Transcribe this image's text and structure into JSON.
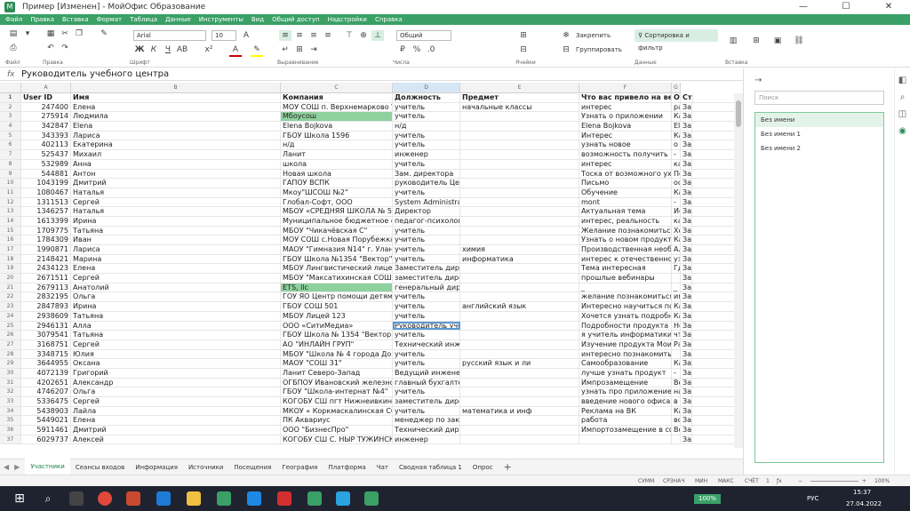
{
  "window": {
    "title": "Пример [Изменен] - МойОфис Образование",
    "logo": "М"
  },
  "menu": [
    "Файл",
    "Правка",
    "Вставка",
    "Формат",
    "Таблица",
    "Данные",
    "Инструменты",
    "Вид",
    "Общий доступ",
    "Надстройки",
    "Справка"
  ],
  "ribbon": {
    "groups": [
      "Файл",
      "Правка",
      "Шрифт",
      "Выравнивание",
      "Числа",
      "Ячейки",
      "Данные",
      "Вставка"
    ],
    "font_name": "Arial",
    "font_size": "10",
    "number_format": "Общий",
    "freeze_label": "Закрепить",
    "group_label": "Группировать",
    "sort_filter_label": "Сортировка и фильтр"
  },
  "formula": {
    "fx": "fx",
    "value": "Руководитель учебного центра"
  },
  "columns": [
    "A",
    "B",
    "C",
    "D",
    "E",
    "F",
    "G"
  ],
  "headers": [
    "User ID",
    "Имя",
    "Компания",
    "Должность",
    "Предмет",
    "Что вас привело на вебина",
    "Ответ на какой вопр",
    "Ст"
  ],
  "rows": [
    [
      "2",
      "247400",
      "Елена",
      "МОУ СОШ п. Верхнемарково УКМО",
      "учитель",
      "начальные классы",
      "интерес",
      "рассылка",
      "За"
    ],
    [
      "3",
      "275914",
      "Людмила",
      "Мбоусош",
      "учитель",
      "",
      "Узнать о приложении",
      "Как начать работать в п",
      "За"
    ],
    [
      "4",
      "342847",
      "Elena",
      "Elena Bojkova",
      "н/д",
      "",
      "Elena Bojkova",
      "Elena Bojkova",
      "За"
    ],
    [
      "5",
      "343393",
      "Лариса",
      "ГБОУ Школа 1596",
      "учитель",
      "",
      "Интерес",
      "Как освоить новые прил",
      "За"
    ],
    [
      "6",
      "402113",
      "Екатерина",
      "н/д",
      "учитель",
      "",
      "узнать новое",
      "о чем вебинар",
      "За"
    ],
    [
      "7",
      "525437",
      "Михаил",
      "Ланит",
      "инженер",
      "",
      "возможность получить новые з",
      "-",
      "За"
    ],
    [
      "8",
      "532989",
      "Анна",
      "школа",
      "учитель",
      "",
      "интерес",
      "как использовать в школ",
      "За"
    ],
    [
      "9",
      "544881",
      "Антон",
      "Новая школа",
      "Зам. директора",
      "",
      "Тоска от возможного ухода Mic",
      "Познакомиться с продук",
      "За"
    ],
    [
      "10",
      "1043199",
      "Дмитрий",
      "ГАПОУ ВСПК",
      "руководитель Центра",
      "",
      "Письмо",
      "основные функции Мой",
      "За"
    ],
    [
      "11",
      "1080467",
      "Наталья",
      "Мкоу\"ШСОШ №2\"",
      "учитель",
      "",
      "Обучение",
      "Как использовать мой о",
      "За"
    ],
    [
      "12",
      "1311513",
      "Сергей",
      "Глобал-Софт, ООО",
      "System Administrator",
      "",
      "mont",
      "-",
      "За"
    ],
    [
      "13",
      "1346257",
      "Наталья",
      "МБОУ «СРЕДНЯЯ ШКОЛА № 5»",
      "Директор",
      "",
      "Актуальная тема",
      "Использование продукт",
      "За"
    ],
    [
      "14",
      "1613399",
      "Ирина",
      "Муниципальное бюджетное общеобразовательное учре",
      "педагог-психолог",
      "",
      "интерес, реальность",
      "как я могу использовать",
      "За"
    ],
    [
      "15",
      "1709775",
      "Татьяна",
      "МБОУ \"Чикачёвская С\"",
      "учитель",
      "",
      "Желание познакомиться с офи",
      "Хотелось бы узнать про",
      "За"
    ],
    [
      "16",
      "1784309",
      "Иван",
      "МОУ СОШ с.Новая Порубежка",
      "учитель",
      "",
      "Узнать о новом продукте Мой о",
      "Как скачать, установить",
      "За"
    ],
    [
      "17",
      "1990871",
      "Лариса",
      "МАОУ \"Гимназия N14\" г. Улан-Удэ",
      "учитель",
      "химия",
      "Производственная необходимо",
      "Алгоритм работы с прод",
      "За"
    ],
    [
      "18",
      "2148421",
      "Марина",
      "ГБОУ Школа №1354 \"Вектор\"",
      "учитель",
      "информатика",
      "интерес к отечественному ПО",
      "узнать о продукте, возм",
      "За"
    ],
    [
      "19",
      "2434123",
      "Елена",
      "МБОУ Лингвистический лицей 22",
      "Заместитель директора",
      "",
      "Тема интересная",
      "Где можно скачать ПО",
      "За"
    ],
    [
      "20",
      "2671511",
      "Сергей",
      "МБОУ \"Максатихинская СОШ № 2\"",
      "заместитель директора по ИКТ",
      "",
      "прошлые вебинары",
      "",
      "За"
    ],
    [
      "21",
      "2679113",
      "Анатолий",
      "ETS, llc",
      "генеральный директор",
      "",
      "_",
      "_",
      "За"
    ],
    [
      "22",
      "2832195",
      "Ольга",
      "ГОУ ЯО Центр помощи детям",
      "учитель",
      "",
      "желание познакомиться с возм",
      "имеет ли приложение в",
      "За"
    ],
    [
      "23",
      "2847893",
      "Ирина",
      "ГБОУ СОШ 501",
      "учитель",
      "английский язык",
      "Интересно научиться пользова",
      "Какие возможности для",
      "За"
    ],
    [
      "24",
      "2938609",
      "Татьяна",
      "МБОУ Лицей 123",
      "учитель",
      "",
      "Хочется узнать подробнее",
      "Как это работает",
      "За"
    ],
    [
      "25",
      "2946131",
      "Алла",
      "ООО «СитиМедиа»",
      "Руководитель учебного центра",
      "",
      "Подробности продукта",
      "Новинки",
      "За"
    ],
    [
      "26",
      "3079541",
      "Татьяна",
      "ГБОУ Школа № 1354 \"Вектор\"",
      "учитель",
      "",
      "я учитель информатики, хочу уз",
      "что такое МойОфис",
      "За"
    ],
    [
      "27",
      "3168751",
      "Сергей",
      "АО \"ИНЛАЙН ГРУП\"",
      "Технический инженер",
      "",
      "Изучение продукта Мои офис",
      "Работа с функциями про",
      "За"
    ],
    [
      "28",
      "3348715",
      "Юлия",
      "МБОУ \"Школа № 4 города Докучаевска\" ДНР",
      "учитель",
      "",
      "интересно познакомиться с пр",
      "",
      "За"
    ],
    [
      "29",
      "3644955",
      "Оксана",
      "МАОУ \"СОШ 31\"",
      "учитель",
      "русский язык и ли",
      "Самообразование",
      "Как сделать процесс об",
      "За"
    ],
    [
      "30",
      "4072139",
      "Григорий",
      "Ланит Северо-Запад",
      "Ведущий инженер",
      "",
      "лучше узнать продукт",
      "-",
      "За"
    ],
    [
      "31",
      "4202651",
      "Александр",
      "ОГБПОУ Ивановский железнодорожный колледж",
      "главный бухгалтер",
      "",
      "Импрозамещение",
      "Возможность беспробле",
      "За"
    ],
    [
      "32",
      "4746207",
      "Ольга",
      "ГБОУ \"Школа-интернат №4\"",
      "учитель",
      "",
      "узнать про приложение \"МойОф",
      "научиться пользоваться",
      "За"
    ],
    [
      "33",
      "5336475",
      "Сергей",
      "КОГОБУ СШ пгт Нижнеивкино Куменского района",
      "заместитель директора",
      "",
      "введение нового офиса",
      "в чем отличие Мой офи",
      "За"
    ],
    [
      "34",
      "5438903",
      "Лайла",
      "МКОУ « Коркмаскалинская СОШ»",
      "учитель",
      "математика и инф",
      "Реклама на ВК",
      "Как работать на этой пр",
      "За"
    ],
    [
      "35",
      "5449021",
      "Елена",
      "ПК Аквариус",
      "менеджер по закупкам",
      "",
      "работа",
      "возможности продукта",
      "За"
    ],
    [
      "36",
      "5911461",
      "Дмитрий",
      "ООО \"БизнесПро\"",
      "Технический директор",
      "",
      "Импортозамещение в сфере П",
      "Возможности продукта",
      "За"
    ],
    [
      "37",
      "6029737",
      "Алексей",
      "КОГОБУ СШ С. НЫР ТУЖИНСКОГО РАЙОНА",
      "инженер",
      "",
      "",
      "",
      "За"
    ]
  ],
  "sheets": [
    "Участники",
    "Сеансы входов",
    "Информация",
    "Источники",
    "Посещения",
    "География",
    "Платформа",
    "Чат",
    "Сводная таблица 1",
    "Опрос"
  ],
  "status": {
    "sum": "СУММ",
    "avg": "СРЗНАЧ",
    "min": "МИН",
    "max": "МАКС",
    "count": "СЧЁТ",
    "count_value": "1",
    "zoom": "100%"
  },
  "side_panel": {
    "search_placeholder": "Поиск",
    "items": [
      "Без имени",
      "Без имени 1",
      "Без имени 2"
    ]
  },
  "taskbar": {
    "lang": "РУС",
    "time": "15:37",
    "date": "27.04.2022"
  }
}
